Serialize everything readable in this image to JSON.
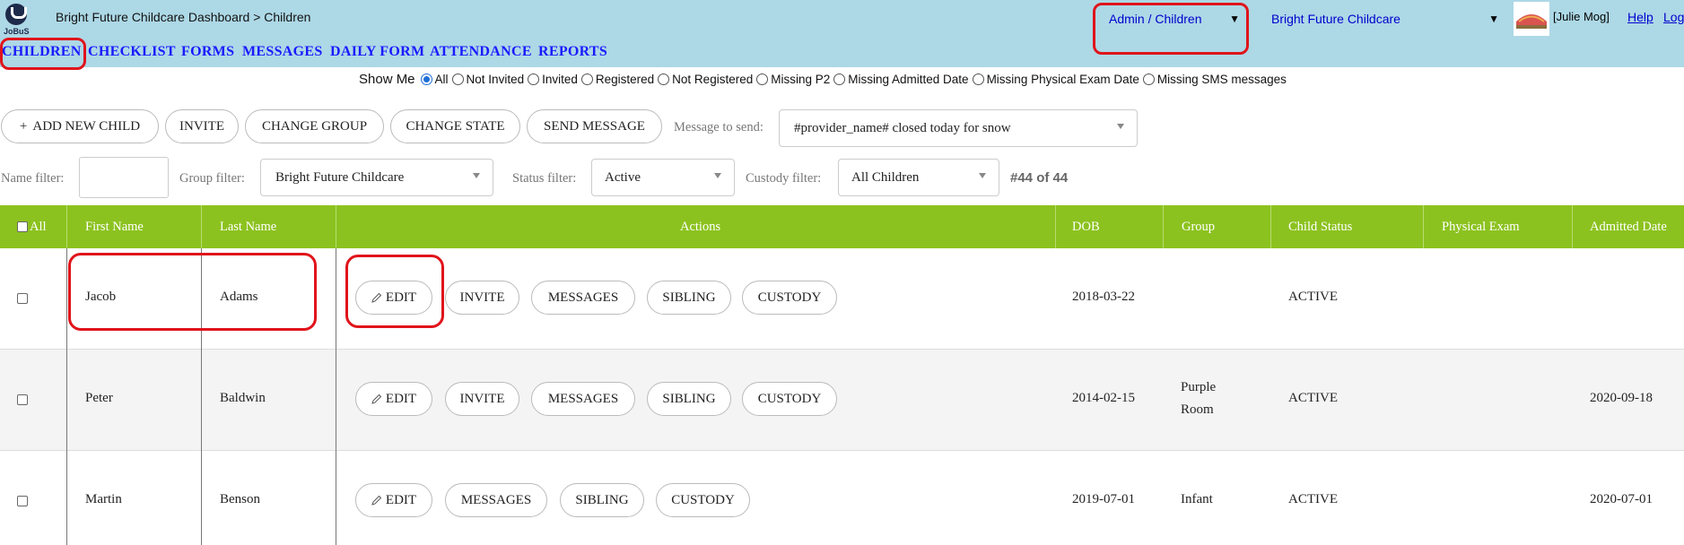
{
  "header": {
    "logo_text": "JoBuS",
    "breadcrumb": "Bright Future Childcare Dashboard > Children",
    "role_select": "Admin / Children",
    "center_select": "Bright Future Childcare",
    "user": "[Julie Mog]",
    "help": "Help",
    "logout": "Log"
  },
  "nav": [
    "CHILDREN",
    "CHECKLIST",
    "FORMS",
    "MESSAGES",
    "DAILY FORM",
    "ATTENDANCE",
    "REPORTS"
  ],
  "show_me": {
    "label": "Show Me",
    "selected": "All",
    "options": [
      "All",
      "Not Invited",
      "Invited",
      "Registered",
      "Not Registered",
      "Missing P2",
      "Missing Admitted Date",
      "Missing Physical Exam Date",
      "Missing SMS messages"
    ]
  },
  "toolbar": {
    "add_child": "ADD NEW CHILD",
    "invite": "INVITE",
    "change_group": "CHANGE GROUP",
    "change_state": "CHANGE STATE",
    "send_message": "SEND MESSAGE",
    "message_label": "Message to send:",
    "message_value": "#provider_name# closed today for snow"
  },
  "filters": {
    "name_label": "Name filter:",
    "name_value": "",
    "group_label": "Group filter:",
    "group_value": "Bright Future Childcare",
    "status_label": "Status filter:",
    "status_value": "Active",
    "custody_label": "Custody filter:",
    "custody_value": "All Children",
    "count": "#44 of 44"
  },
  "table": {
    "headers": {
      "all": "All",
      "first": "First Name",
      "last": "Last Name",
      "actions": "Actions",
      "dob": "DOB",
      "group": "Group",
      "status": "Child Status",
      "exam": "Physical Exam",
      "admitted": "Admitted Date"
    },
    "rows": [
      {
        "first": "Jacob",
        "last": "Adams",
        "dob": "2018-03-22",
        "group1": "",
        "group2": "",
        "status": "ACTIVE",
        "exam": "",
        "admitted": "",
        "actions": [
          "EDIT",
          "INVITE",
          "MESSAGES",
          "SIBLING",
          "CUSTODY"
        ]
      },
      {
        "first": "Peter",
        "last": "Baldwin",
        "dob": "2014-02-15",
        "group1": "Purple",
        "group2": "Room",
        "status": "ACTIVE",
        "exam": "",
        "admitted": "2020-09-18",
        "actions": [
          "EDIT",
          "INVITE",
          "MESSAGES",
          "SIBLING",
          "CUSTODY"
        ]
      },
      {
        "first": "Martin",
        "last": "Benson",
        "dob": "2019-07-01",
        "group1": "Infant",
        "group2": "",
        "status": "ACTIVE",
        "exam": "",
        "admitted": "2020-07-01",
        "actions": [
          "EDIT",
          "MESSAGES",
          "SIBLING",
          "CUSTODY"
        ]
      }
    ]
  },
  "colors": {
    "header_bg": "#add8e6",
    "nav_text": "#1a1aff",
    "table_header": "#8cc21f",
    "highlight": "#e0141b"
  }
}
